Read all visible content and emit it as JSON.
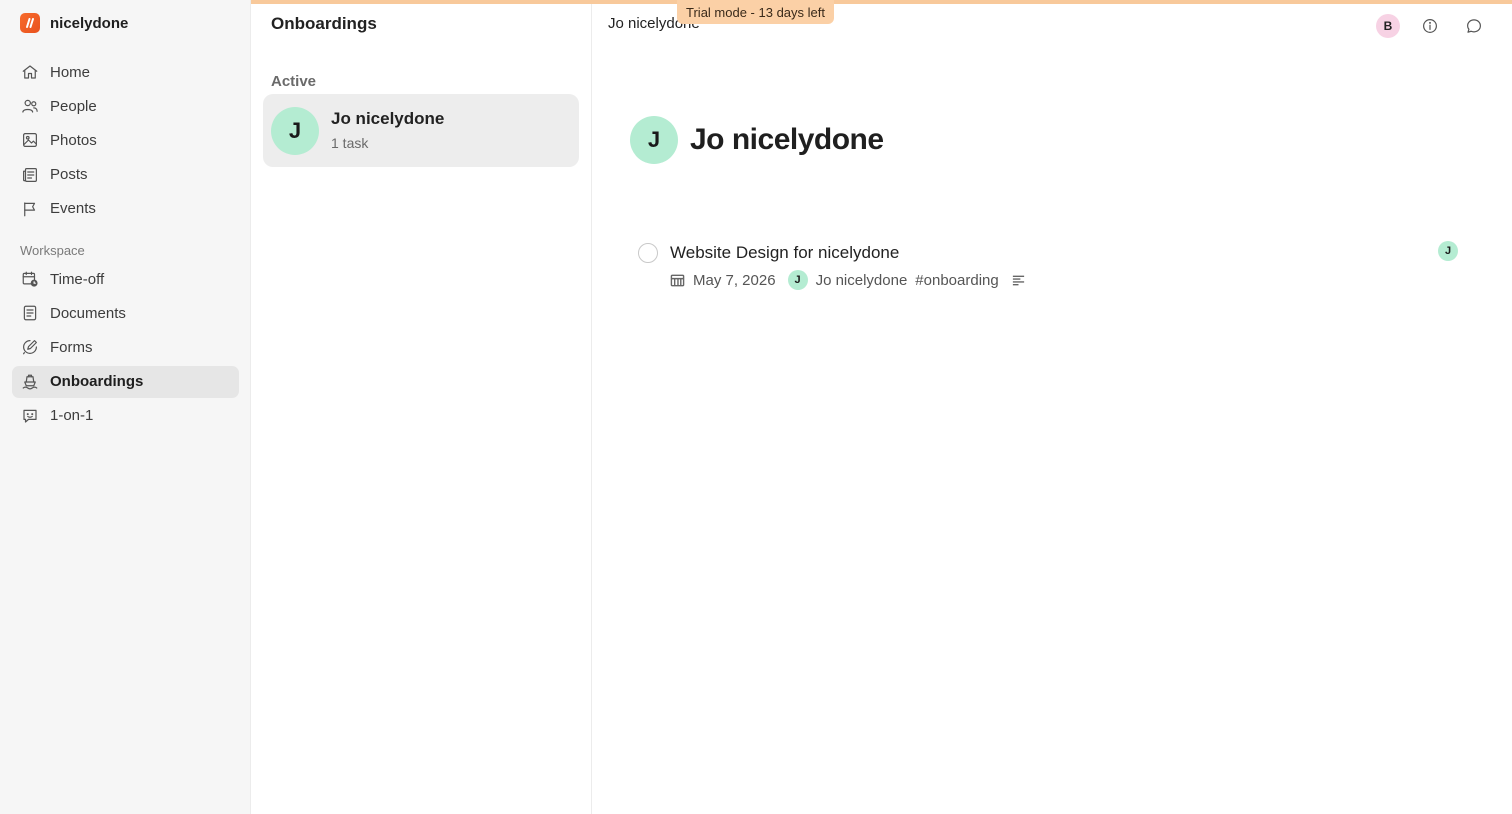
{
  "trial_banner": "Trial mode - 13 days left",
  "brand": {
    "name": "nicelydone"
  },
  "sidebar": {
    "primary": [
      {
        "label": "Home",
        "icon": "home-icon"
      },
      {
        "label": "People",
        "icon": "people-icon"
      },
      {
        "label": "Photos",
        "icon": "photo-icon"
      },
      {
        "label": "Posts",
        "icon": "posts-icon"
      },
      {
        "label": "Events",
        "icon": "flag-icon"
      }
    ],
    "section_label": "Workspace",
    "workspace": [
      {
        "label": "Time-off",
        "icon": "calendar-clock-icon"
      },
      {
        "label": "Documents",
        "icon": "document-icon"
      },
      {
        "label": "Forms",
        "icon": "form-icon"
      },
      {
        "label": "Onboardings",
        "icon": "onboarding-icon",
        "active": true
      },
      {
        "label": "1-on-1",
        "icon": "chat-smile-icon"
      }
    ]
  },
  "middle": {
    "title": "Onboardings",
    "section": "Active",
    "items": [
      {
        "initial": "J",
        "name": "Jo nicelydone",
        "sub": "1 task"
      }
    ]
  },
  "main": {
    "breadcrumb": "Jo nicelydone",
    "user_initial": "B",
    "profile": {
      "initial": "J",
      "name": "Jo nicelydone"
    },
    "task": {
      "title": "Website Design for nicelydone",
      "date": "May 7, 2026",
      "assignee_initial": "J",
      "assignee_name": "Jo nicelydone",
      "tag": "#onboarding"
    }
  },
  "colors": {
    "brand": "#f0622a",
    "avatar_green": "#b4ecd2",
    "avatar_pink": "#f7d2e4",
    "trial_banner": "#fbd0a6"
  }
}
